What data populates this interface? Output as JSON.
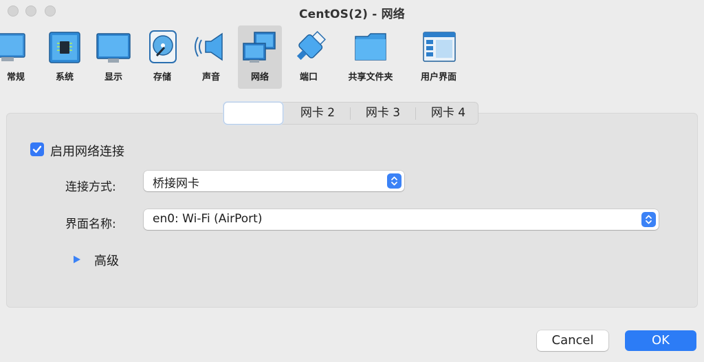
{
  "window": {
    "title": "CentOS(2) - 网络"
  },
  "toolbar": {
    "items": [
      {
        "label": "常规",
        "icon": "monitor-general-icon",
        "selected": false
      },
      {
        "label": "系统",
        "icon": "chip-icon",
        "selected": false
      },
      {
        "label": "显示",
        "icon": "display-icon",
        "selected": false
      },
      {
        "label": "存储",
        "icon": "disk-icon",
        "selected": false
      },
      {
        "label": "声音",
        "icon": "speaker-icon",
        "selected": false
      },
      {
        "label": "网络",
        "icon": "network-icon",
        "selected": true
      },
      {
        "label": "端口",
        "icon": "port-icon",
        "selected": false
      },
      {
        "label": "共享文件夹",
        "icon": "folder-icon",
        "selected": false
      },
      {
        "label": "用户界面",
        "icon": "user-interface-icon",
        "selected": false
      }
    ]
  },
  "tabs": {
    "items": [
      {
        "label": "",
        "selected": true
      },
      {
        "label": "网卡 2",
        "selected": false
      },
      {
        "label": "网卡 3",
        "selected": false
      },
      {
        "label": "网卡 4",
        "selected": false
      }
    ]
  },
  "adapter": {
    "enable_label": "启用网络连接",
    "enabled": true,
    "attached_label": "连接方式:",
    "attached_value": "桥接网卡",
    "name_label": "界面名称:",
    "name_value": "en0: Wi-Fi (AirPort)",
    "advanced_label": "高级"
  },
  "buttons": {
    "cancel": "Cancel",
    "ok": "OK"
  },
  "colors": {
    "accent": "#3478f6",
    "window_bg": "#ececec",
    "panel_bg": "#e3e3e3"
  }
}
